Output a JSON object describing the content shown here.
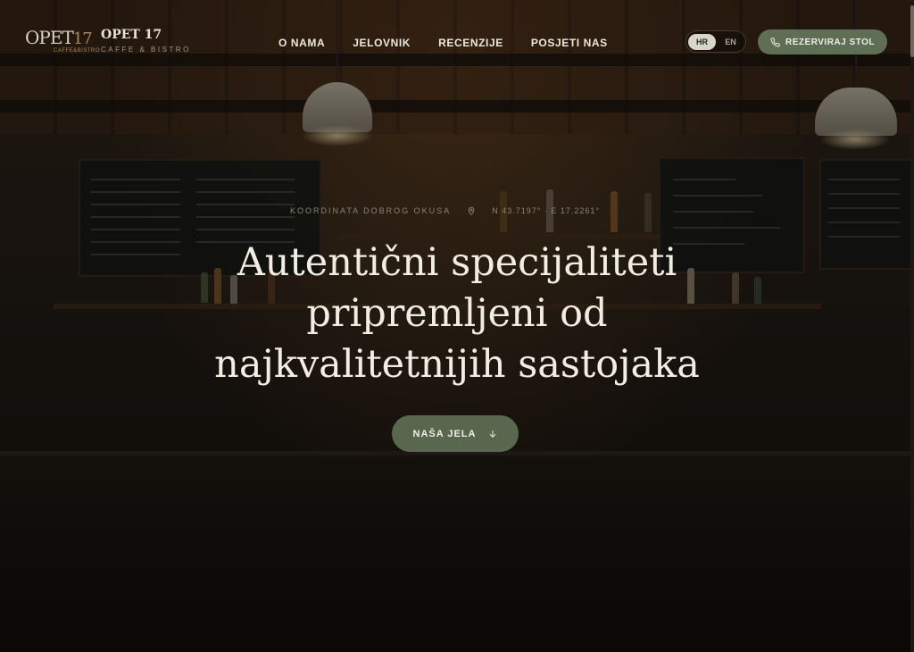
{
  "brand": {
    "logo_text": "OPET",
    "logo_number": "17",
    "logo_sub": "CAFFE&BISTRO",
    "name": "OPET 17",
    "tagline": "CAFFE & BISTRO"
  },
  "nav": {
    "items": [
      {
        "label": "O NAMA"
      },
      {
        "label": "JELOVNIK"
      },
      {
        "label": "RECENZIJE"
      },
      {
        "label": "POSJETI NAS"
      }
    ]
  },
  "language": {
    "options": [
      "HR",
      "EN"
    ],
    "selected": "HR"
  },
  "reserve_button": {
    "label": "REZERVIRAJ STOL",
    "icon": "phone-icon"
  },
  "hero": {
    "kicker": "KOORDINATA DOBROG OKUSA",
    "coordinates": "N 43.7197° · E 17.2261°",
    "coordinates_icon": "map-pin-icon",
    "title_lines": [
      "Autentični specijaliteti",
      "pripremljeni od",
      "najkvalitetnijih sastojaka"
    ],
    "cta_label": "NAŠA JELA",
    "cta_icon": "arrow-down-icon"
  },
  "colors": {
    "accent_green": "#5e6f55",
    "text_light": "#f1ede2",
    "gold": "#a58c5a"
  }
}
